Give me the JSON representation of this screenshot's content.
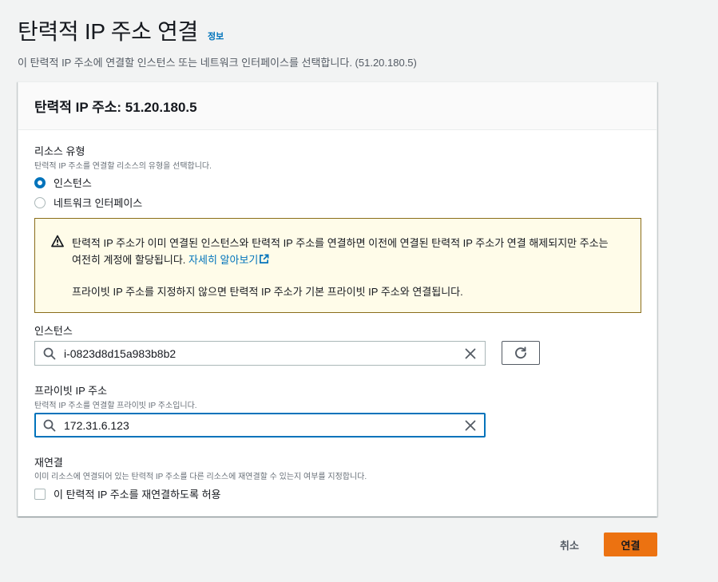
{
  "page": {
    "title": "탄력적 IP 주소 연결",
    "info_link": "정보",
    "description": "이 탄력적 IP 주소에 연결할 인스턴스 또는 네트워크 인터페이스를 선택합니다. (51.20.180.5)"
  },
  "panel": {
    "header": "탄력적 IP 주소: 51.20.180.5"
  },
  "resource_type": {
    "label": "리소스 유형",
    "description": "탄력적 IP 주소를 연결할 리소스의 유형을 선택합니다.",
    "options": [
      {
        "label": "인스턴스",
        "selected": true
      },
      {
        "label": "네트워크 인터페이스",
        "selected": false
      }
    ]
  },
  "alert": {
    "text_line1": "탄력적 IP 주소가 이미 연결된 인스턴스와 탄력적 IP 주소를 연결하면 이전에 연결된 탄력적 IP 주소가 연결 해제되지만 주소는",
    "text_line2": "여전히 계정에 할당됩니다.",
    "link": "자세히 알아보기",
    "text_line3": "프라이빗 IP 주소를 지정하지 않으면 탄력적 IP 주소가 기본 프라이빗 IP 주소와 연결됩니다."
  },
  "instance": {
    "label": "인스턴스",
    "value": "i-0823d8d15a983b8b2"
  },
  "private_ip": {
    "label": "프라이빗 IP 주소",
    "description": "탄력적 IP 주소를 연결할 프라이빗 IP 주소입니다.",
    "value": "172.31.6.123"
  },
  "reassociation": {
    "label": "재연결",
    "description": "이미 리소스에 연결되어 있는 탄력적 IP 주소를 다른 리소스에 재연결할 수 있는지 여부를 지정합니다.",
    "checkbox_label": "이 탄력적 IP 주소를 재연결하도록 허용",
    "checked": false
  },
  "actions": {
    "cancel": "취소",
    "associate": "연결"
  },
  "colors": {
    "primary": "#ec7211",
    "link": "#0073bb",
    "warning_bg": "#fffce9",
    "warning_border": "#8a6d1a"
  }
}
